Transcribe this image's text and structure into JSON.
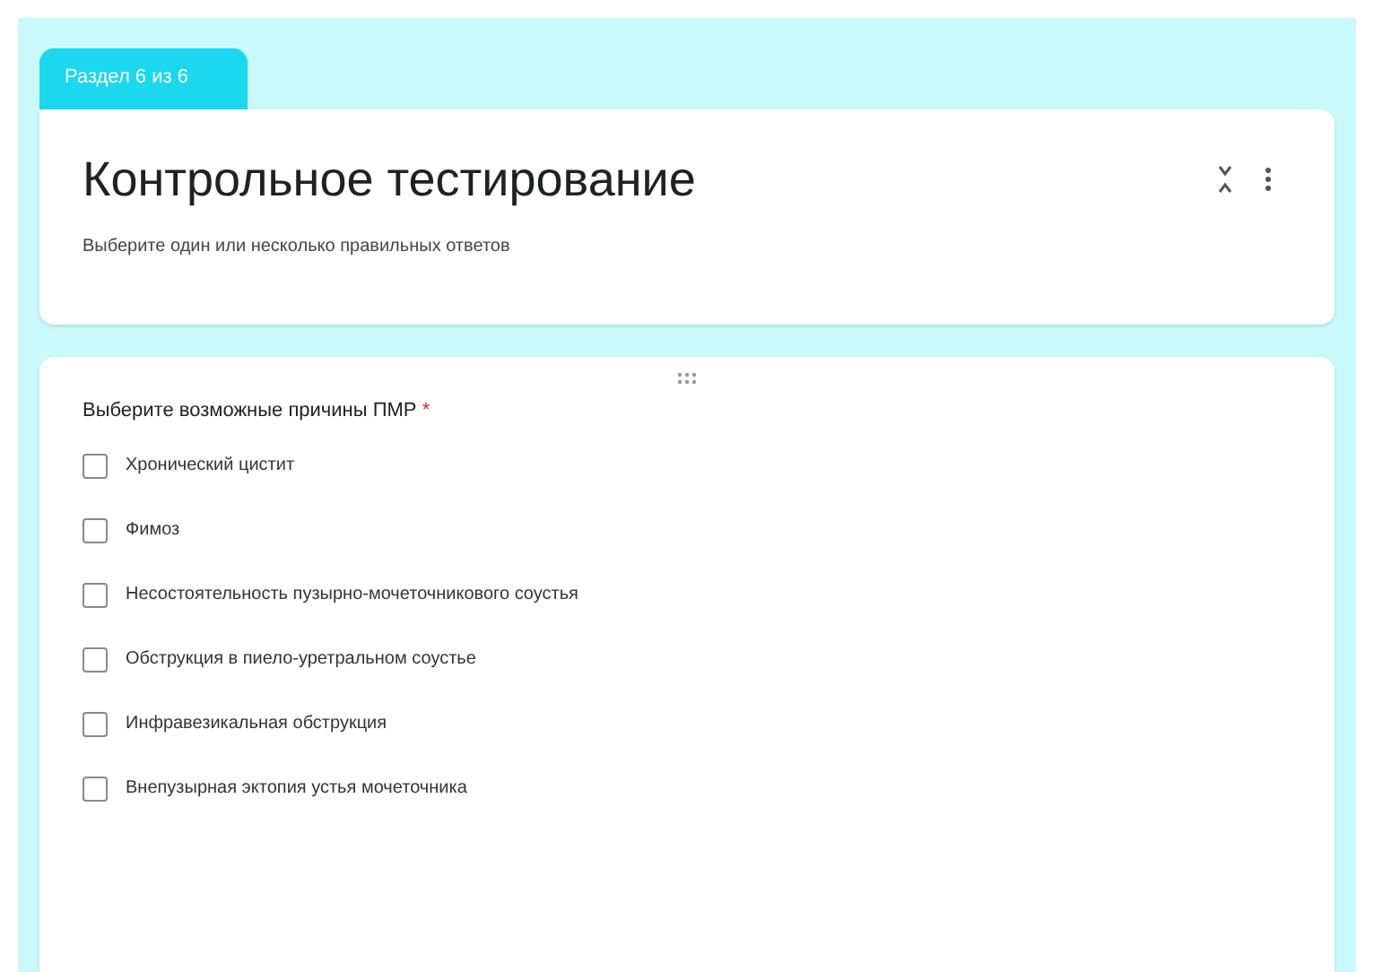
{
  "section_tab": {
    "label": "Раздел 6 из 6"
  },
  "header": {
    "title": "Контрольное тестирование",
    "description": "Выберите один или несколько правильных ответов"
  },
  "question": {
    "title": "Выберите возможные причины ПМР",
    "required": true,
    "required_mark": "*",
    "options": [
      {
        "label": "Хронический цистит",
        "checked": false
      },
      {
        "label": "Фимоз",
        "checked": false
      },
      {
        "label": "Несостоятельность пузырно-мочеточникового соустья",
        "checked": false
      },
      {
        "label": "Обструкция в пиело-уретральном соустье",
        "checked": false
      },
      {
        "label": "Инфравезикальная обструкция",
        "checked": false
      },
      {
        "label": "Внепузырная эктопия устья мочеточника",
        "checked": false
      }
    ]
  }
}
